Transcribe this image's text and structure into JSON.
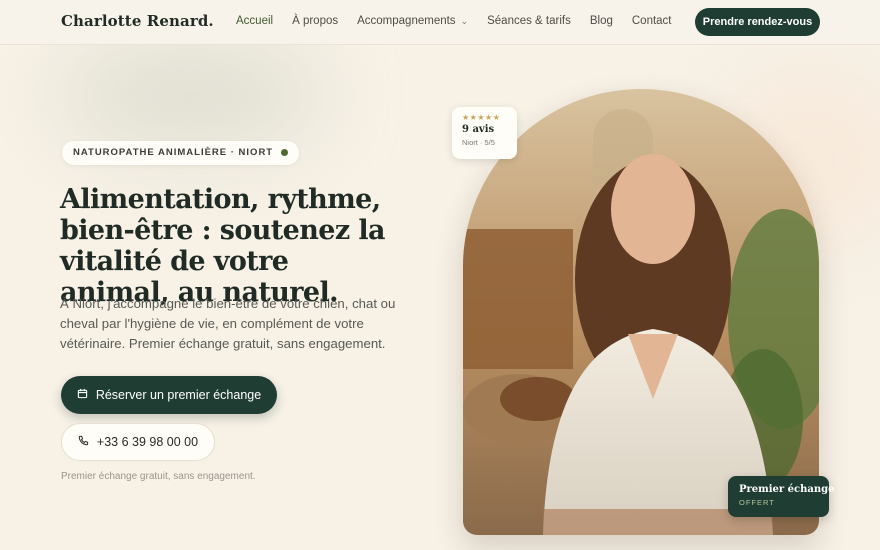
{
  "brand": {
    "name": "Charlotte Renard."
  },
  "nav": {
    "items": [
      {
        "label": "Accueil"
      },
      {
        "label": "À propos"
      },
      {
        "label": "Accompagnements"
      },
      {
        "label": "Séances & tarifs"
      },
      {
        "label": "Blog"
      },
      {
        "label": "Contact"
      }
    ],
    "cta_label": "Prendre rendez-vous"
  },
  "hero": {
    "badge": "NATUROPATHE ANIMALIÈRE · NIORT",
    "headline": "Alimentation, rythme, bien-être : soutenez la vitalité de votre animal, au naturel.",
    "lead": "À Niort, j'accompagne le bien-être de votre chien, chat ou cheval par l'hygiène de vie, en complément de votre vétérinaire. Premier échange gratuit, sans engagement.",
    "primary_button": "Réserver un premier échange",
    "phone_button": "+33 6 39 98 00 00",
    "note": "Premier échange gratuit, sans engagement."
  },
  "rating": {
    "stars": "★★★★★",
    "count": "9 avis",
    "sub": "Niort · 5/5"
  },
  "offer": {
    "title": "Premier échange",
    "sub": "OFFERT"
  },
  "colors": {
    "accent": "#1f3d33",
    "background": "#f7f1e6",
    "nav_active": "#3f5a2e",
    "star": "#c9a35a"
  }
}
